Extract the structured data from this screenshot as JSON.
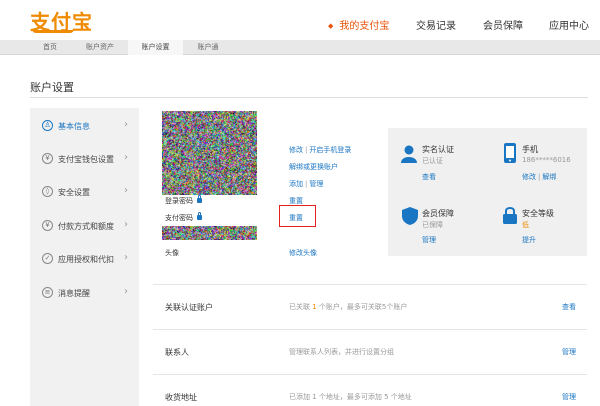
{
  "header": {
    "logo_text": "支付宝",
    "nav": [
      "我的支付宝",
      "交易记录",
      "会员保障",
      "应用中心"
    ]
  },
  "subnav": [
    "首页",
    "账户资产",
    "账户设置",
    "账户通"
  ],
  "page_title": "账户设置",
  "sidebar": [
    {
      "label": "基本信息",
      "icon": "user-icon",
      "glyph": "♙"
    },
    {
      "label": "支付宝钱包设置",
      "icon": "wallet-icon",
      "glyph": "¥"
    },
    {
      "label": "安全设置",
      "icon": "shield-icon",
      "glyph": "◊"
    },
    {
      "label": "付款方式和额度",
      "icon": "yuan-icon",
      "glyph": "¥"
    },
    {
      "label": "应用授权和代扣",
      "icon": "check-icon",
      "glyph": "✓"
    },
    {
      "label": "消息提醒",
      "icon": "message-icon",
      "glyph": "≡"
    }
  ],
  "account": {
    "login_pwd_label": "登录密码",
    "pay_pwd_label": "支付密码",
    "avatar_label": "头像",
    "link_modify": "修改",
    "link_mobile_login": "开启手机登录",
    "link_unbind": "解绑或更换账户",
    "link_add": "添加",
    "link_manage": "管理",
    "link_reset_1": "重置",
    "link_reset_2": "重置",
    "link_modify_avatar": "修改头像"
  },
  "info_panel": {
    "realname_title": "实名认证",
    "realname_status": "已认证",
    "realname_action": "查看",
    "phone_title": "手机",
    "phone_number": "186*****6016",
    "phone_modify": "修改",
    "phone_unbind": "解绑",
    "vip_title": "会员保障",
    "vip_status": "已保障",
    "vip_action": "管理",
    "security_title": "安全等级",
    "security_level": "低",
    "security_action": "提升"
  },
  "rows": [
    {
      "label": "关联认证账户",
      "desc_pre": "已关联 ",
      "num": "1",
      "desc_post": " 个账户，最多可关联5个账户",
      "action": "查看"
    },
    {
      "label": "联系人",
      "desc_pre": "管理联系人列表，并进行设置分组",
      "num": "",
      "desc_post": "",
      "action": "管理"
    },
    {
      "label": "收货地址",
      "desc_pre": "已添加 1 个地址，最多可添加 5 个地址",
      "num": "",
      "desc_post": "",
      "action": "管理"
    }
  ],
  "colors": {
    "brand_orange": "#f08a00",
    "link_blue": "#1a76c2",
    "highlight_red": "#e3221c"
  }
}
